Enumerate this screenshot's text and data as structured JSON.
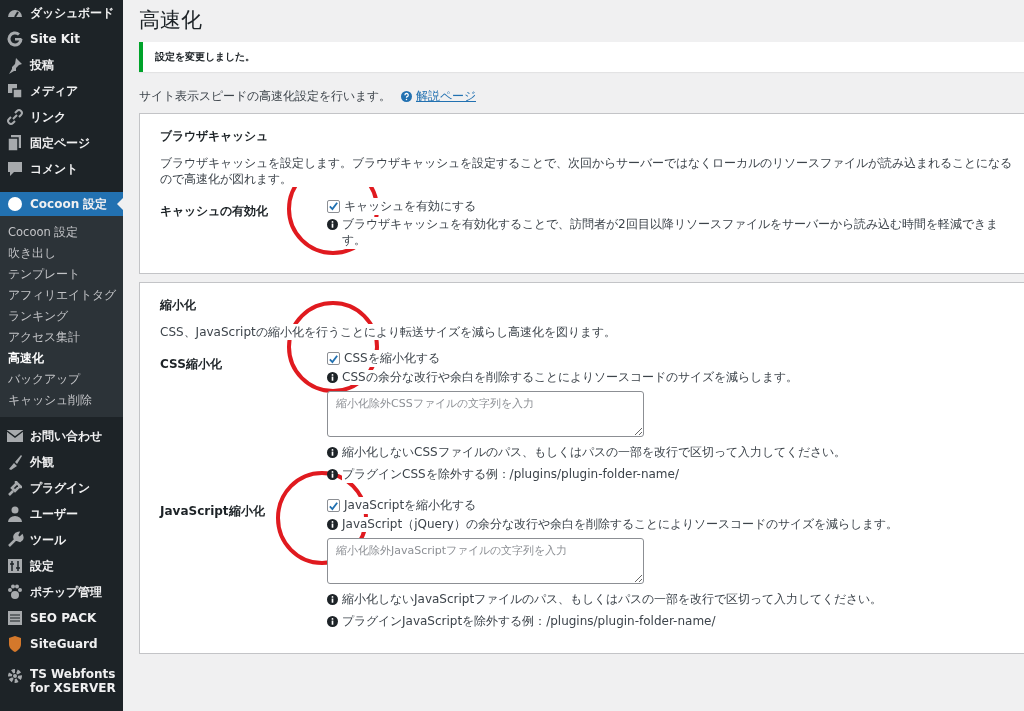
{
  "sidebar": {
    "items": [
      {
        "label": "ダッシュボード",
        "selected": false
      },
      {
        "label": "Site Kit",
        "selected": false
      },
      {
        "label": "投稿",
        "selected": false
      },
      {
        "label": "メディア",
        "selected": false
      },
      {
        "label": "リンク",
        "selected": false
      },
      {
        "label": "固定ページ",
        "selected": false
      },
      {
        "label": "コメント",
        "selected": false
      },
      {
        "label": "Cocoon 設定",
        "selected": true,
        "children": [
          {
            "label": "Cocoon 設定",
            "selected": false
          },
          {
            "label": "吹き出し",
            "selected": false
          },
          {
            "label": "テンプレート",
            "selected": false
          },
          {
            "label": "アフィリエイトタグ",
            "selected": false
          },
          {
            "label": "ランキング",
            "selected": false
          },
          {
            "label": "アクセス集計",
            "selected": false
          },
          {
            "label": "高速化",
            "selected": true
          },
          {
            "label": "バックアップ",
            "selected": false
          },
          {
            "label": "キャッシュ削除",
            "selected": false
          }
        ]
      },
      {
        "label": "お問い合わせ",
        "selected": false
      },
      {
        "label": "外観",
        "selected": false
      },
      {
        "label": "プラグイン",
        "selected": false
      },
      {
        "label": "ユーザー",
        "selected": false
      },
      {
        "label": "ツール",
        "selected": false
      },
      {
        "label": "設定",
        "selected": false
      },
      {
        "label": "ポチップ管理",
        "selected": false
      },
      {
        "label": "SEO PACK",
        "selected": false
      },
      {
        "label": "SiteGuard",
        "selected": false
      },
      {
        "label": "TS Webfonts for XSERVER",
        "selected": false
      }
    ]
  },
  "page_title": "高速化",
  "notice": "設定を変更しました。",
  "intro": {
    "text": "サイト表示スピードの高速化設定を行います。",
    "link": "解説ページ"
  },
  "sections": [
    {
      "title": "ブラウザキャッシュ",
      "description": "ブラウザキャッシュを設定します。ブラウザキャッシュを設定することで、次回からサーバーではなくローカルのリソースファイルが読み込まれることになるので高速化が図れます。",
      "rows": [
        {
          "label": "キャッシュの有効化",
          "checkbox": {
            "label": "キャッシュを有効にする",
            "checked": true
          },
          "help": "ブラウザキャッシュを有効化することで、訪問者が2回目以降リソースファイルをサーバーから読み込む時間を軽減できます。",
          "notes": []
        }
      ]
    },
    {
      "title": "縮小化",
      "description": "CSS、JavaScriptの縮小化を行うことにより転送サイズを減らし高速化を図ります。",
      "rows": [
        {
          "label": "CSS縮小化",
          "checkbox": {
            "label": "CSSを縮小化する",
            "checked": true
          },
          "help": "CSSの余分な改行や余白を削除することによりソースコードのサイズを減らします。",
          "textarea": {
            "placeholder": "縮小化除外CSSファイルの文字列を入力"
          },
          "notes": [
            "縮小化しないCSSファイルのパス、もしくはパスの一部を改行で区切って入力してください。",
            "プラグインCSSを除外する例：/plugins/plugin-folder-name/"
          ]
        },
        {
          "label": "JavaScript縮小化",
          "checkbox": {
            "label": "JavaScriptを縮小化する",
            "checked": true
          },
          "help": "JavaScript（jQuery）の余分な改行や余白を削除することによりソースコードのサイズを減らします。",
          "textarea": {
            "placeholder": "縮小化除外JavaScriptファイルの文字列を入力"
          },
          "notes": [
            "縮小化しないJavaScriptファイルのパス、もしくはパスの一部を改行で区切って入力してください。",
            "プラグインJavaScriptを除外する例：/plugins/plugin-folder-name/"
          ]
        }
      ]
    }
  ]
}
